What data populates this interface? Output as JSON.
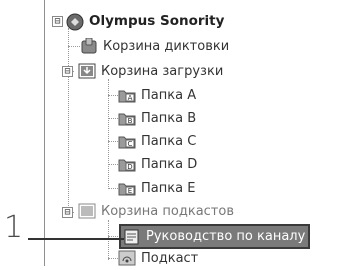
{
  "tree": {
    "root": {
      "label": "Olympus Sonority",
      "expander": "⊟"
    },
    "items": [
      {
        "label": "Корзина диктовки"
      },
      {
        "label": "Корзина загрузки",
        "expander": "⊟"
      },
      {
        "label": "Папка A",
        "letter": "A"
      },
      {
        "label": "Папка B",
        "letter": "B"
      },
      {
        "label": "Папка C",
        "letter": "C"
      },
      {
        "label": "Папка D",
        "letter": "D"
      },
      {
        "label": "Папка E",
        "letter": "E"
      },
      {
        "label": "Корзина подкастов",
        "expander": "⊟"
      },
      {
        "label": "Руководство по каналу"
      },
      {
        "label": "Подкаст"
      }
    ]
  },
  "callout": {
    "number": "1"
  }
}
